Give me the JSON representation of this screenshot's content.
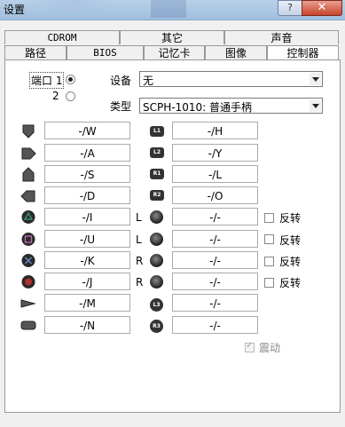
{
  "window": {
    "title": "设置",
    "help": "?",
    "close": "✕"
  },
  "tabs": {
    "row1": [
      "CDROM",
      "其它",
      "声音"
    ],
    "row2": [
      "路径",
      "BIOS",
      "记忆卡",
      "图像",
      "控制器"
    ],
    "active": "控制器"
  },
  "ports": {
    "port1_label": "端口 1",
    "port2_label": "2",
    "selected": "端口 1"
  },
  "device": {
    "label": "设备",
    "value": "无"
  },
  "type": {
    "label": "类型",
    "value": "SCPH-1010: 普通手柄"
  },
  "buttons_left": [
    {
      "icon": "d-pad-up-icon",
      "key": "-/W"
    },
    {
      "icon": "d-pad-right-icon",
      "key": "-/A"
    },
    {
      "icon": "d-pad-down-icon",
      "key": "-/S"
    },
    {
      "icon": "d-pad-left-icon",
      "key": "-/D"
    },
    {
      "icon": "triangle-button-icon",
      "key": "-/I"
    },
    {
      "icon": "square-button-icon",
      "key": "-/U"
    },
    {
      "icon": "cross-button-icon",
      "key": "-/K"
    },
    {
      "icon": "circle-button-icon",
      "key": "-/J"
    },
    {
      "icon": "select-button-icon",
      "key": "-/M"
    },
    {
      "icon": "start-button-icon",
      "key": "-/N"
    }
  ],
  "buttons_right": [
    {
      "icon": "l1-button-icon",
      "badge": "L1",
      "key": "-/H"
    },
    {
      "icon": "l2-button-icon",
      "badge": "L2",
      "key": "-/Y"
    },
    {
      "icon": "r1-button-icon",
      "badge": "R1",
      "key": "-/L"
    },
    {
      "icon": "r2-button-icon",
      "badge": "R2",
      "key": "-/O"
    }
  ],
  "sticks": [
    {
      "side": "L",
      "icon": "left-stick-horizontal-icon",
      "key": "-/-",
      "invert": "反转"
    },
    {
      "side": "L",
      "icon": "left-stick-vertical-icon",
      "key": "-/-",
      "invert": "反转"
    },
    {
      "side": "R",
      "icon": "right-stick-horizontal-icon",
      "key": "-/-",
      "invert": "反转"
    },
    {
      "side": "R",
      "icon": "right-stick-vertical-icon",
      "key": "-/-",
      "invert": "反转"
    }
  ],
  "stick_buttons": [
    {
      "icon": "l3-button-icon",
      "badge": "L3",
      "key": "-/-"
    },
    {
      "icon": "r3-button-icon",
      "badge": "R3",
      "key": "-/-"
    }
  ],
  "vibration": {
    "label": "震动",
    "checked": true,
    "enabled": false
  }
}
